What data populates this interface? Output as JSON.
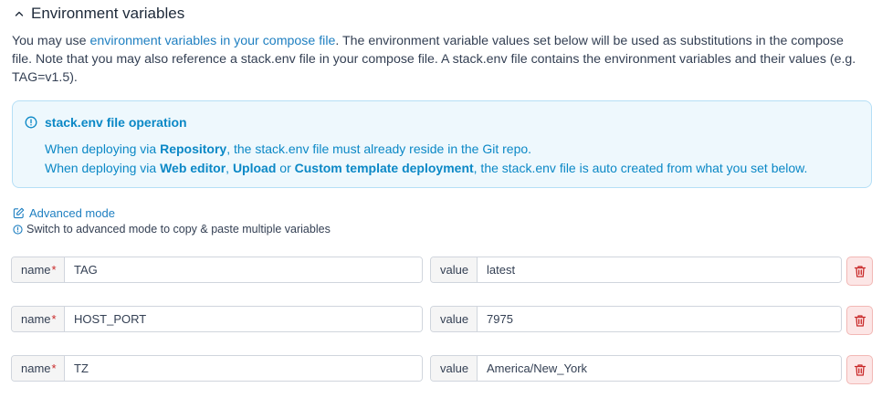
{
  "section": {
    "title": "Environment variables"
  },
  "description": {
    "prefix": "You may use ",
    "link": "environment variables in your compose file",
    "suffix": ". The environment variable values set below will be used as substitutions in the compose file. Note that you may also reference a stack.env file in your compose file. A stack.env file contains the environment variables and their values (e.g. TAG=v1.5)."
  },
  "info": {
    "title": "stack.env file operation",
    "line1_pre": "When deploying via ",
    "line1_bold": "Repository",
    "line1_post": ", the stack.env file must already reside in the Git repo.",
    "line2_pre": "When deploying via ",
    "line2_bold1": "Web editor",
    "line2_sep1": ", ",
    "line2_bold2": "Upload",
    "line2_sep2": " or ",
    "line2_bold3": "Custom template deployment",
    "line2_post": ", the stack.env file is auto created from what you set below."
  },
  "advanced": {
    "link_label": "Advanced mode",
    "hint": "Switch to advanced mode to copy & paste multiple variables"
  },
  "labels": {
    "name": "name",
    "required_mark": "*",
    "value": "value"
  },
  "variables": [
    {
      "name": "TAG",
      "value": "latest"
    },
    {
      "name": "HOST_PORT",
      "value": "7975"
    },
    {
      "name": "TZ",
      "value": "America/New_York"
    }
  ],
  "colors": {
    "link": "#1e7fc1",
    "info_text": "#0b88c6",
    "info_bg": "#eef8fd",
    "danger": "#c92a2a",
    "danger_bg": "#fce6e6"
  },
  "icons": {
    "section_toggle": "chevron-up-icon",
    "info": "info-circle-icon",
    "advanced": "edit-icon",
    "delete": "trash-icon"
  }
}
